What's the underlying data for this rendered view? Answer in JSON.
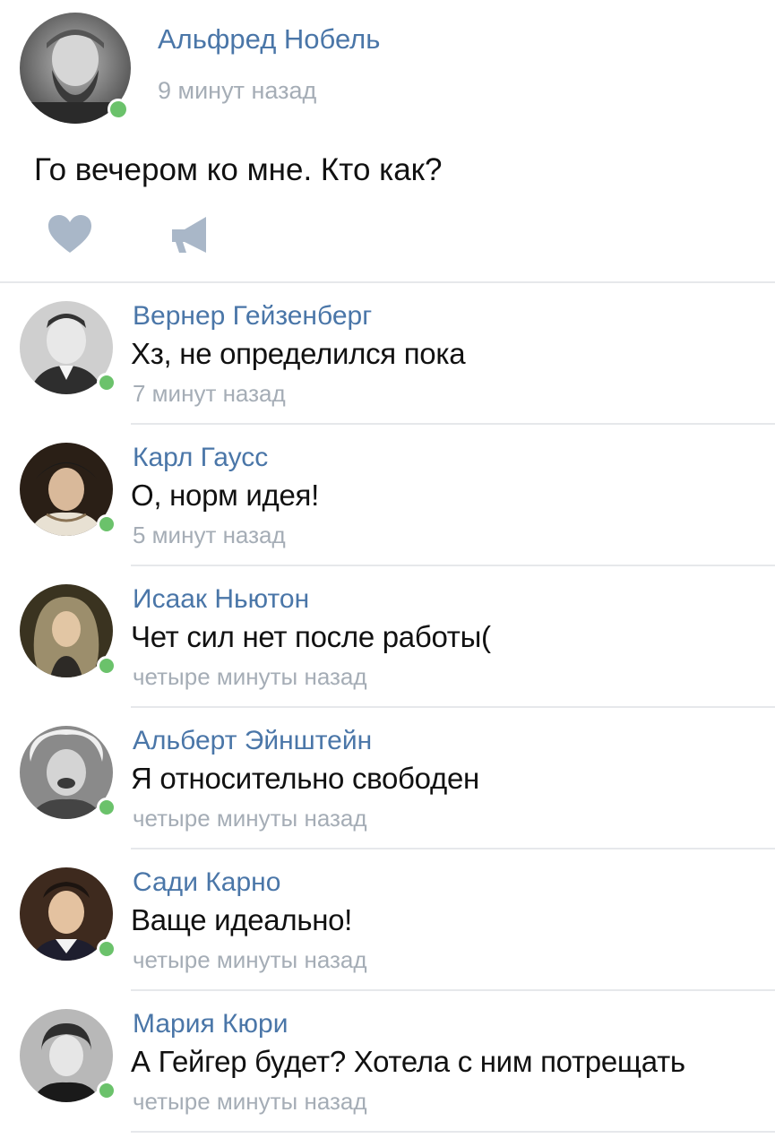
{
  "post": {
    "author": "Альфред Нобель",
    "time": "9 минут назад",
    "text": "Го вечером ко мне. Кто как?",
    "avatar_icon": "person-portrait-icon",
    "actions": [
      {
        "name": "like",
        "icon": "heart-icon"
      },
      {
        "name": "share",
        "icon": "megaphone-icon"
      }
    ]
  },
  "comments": [
    {
      "author": "Вернер Гейзенберг",
      "text": "Хз, не определился пока",
      "time": "7 минут назад"
    },
    {
      "author": "Карл Гаусс",
      "text": "О, норм идея!",
      "time": "5 минут назад"
    },
    {
      "author": "Исаак Ньютон",
      "text": "Чет сил нет после работы(",
      "time": "четыре минуты назад"
    },
    {
      "author": "Альберт Эйнштейн",
      "text": "Я относительно свободен",
      "time": "четыре минуты назад"
    },
    {
      "author": "Сади Карно",
      "text": "Ваще идеально!",
      "time": "четыре минуты назад"
    },
    {
      "author": "Мария Кюри",
      "text": "А Гейгер будет? Хотела с ним потрещать",
      "time": "четыре минуты назад"
    }
  ],
  "colors": {
    "link": "#4a76a8",
    "muted": "#a5adb6",
    "online": "#6bc26b",
    "icon": "#a9b7c8",
    "divider": "#e6e8eb"
  }
}
